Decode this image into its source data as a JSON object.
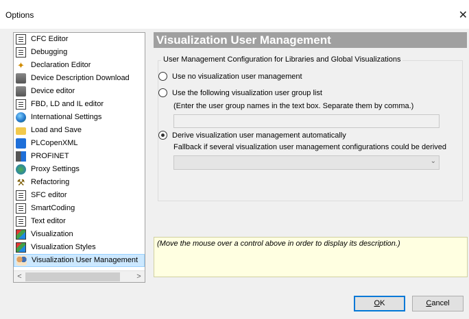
{
  "window": {
    "title": "Options",
    "close_glyph": "✕"
  },
  "tree": {
    "items": [
      {
        "label": "CFC Editor",
        "icon": "doc-icon"
      },
      {
        "label": "Debugging",
        "icon": "debug-icon"
      },
      {
        "label": "Declaration Editor",
        "icon": "declaration-icon"
      },
      {
        "label": "Device Description Download",
        "icon": "device-download-icon"
      },
      {
        "label": "Device editor",
        "icon": "device-icon"
      },
      {
        "label": "FBD, LD and IL editor",
        "icon": "fbd-icon"
      },
      {
        "label": "International Settings",
        "icon": "globe-icon"
      },
      {
        "label": "Load and Save",
        "icon": "folder-icon"
      },
      {
        "label": "PLCopenXML",
        "icon": "plcopen-icon"
      },
      {
        "label": "PROFINET",
        "icon": "profinet-icon"
      },
      {
        "label": "Proxy Settings",
        "icon": "proxy-icon"
      },
      {
        "label": "Refactoring",
        "icon": "refactoring-icon"
      },
      {
        "label": "SFC editor",
        "icon": "sfc-icon"
      },
      {
        "label": "SmartCoding",
        "icon": "smartcoding-icon"
      },
      {
        "label": "Text editor",
        "icon": "text-editor-icon"
      },
      {
        "label": "Visualization",
        "icon": "visualization-icon"
      },
      {
        "label": "Visualization Styles",
        "icon": "visualization-styles-icon"
      },
      {
        "label": "Visualization User Management",
        "icon": "user-management-icon",
        "selected": true
      }
    ],
    "scroll_left": "<",
    "scroll_right": ">"
  },
  "panel": {
    "title": "Visualization User Management",
    "group_label": "User Management Configuration for Libraries and Global Visualizations",
    "options": [
      {
        "label": "Use no visualization user management",
        "checked": false
      },
      {
        "label": "Use the following visualization user group list",
        "checked": false
      },
      {
        "label": "Derive visualization user management automatically",
        "checked": true
      }
    ],
    "group_list_hint": "(Enter the user group names in the text box. Separate them by comma.)",
    "group_list_value": "",
    "fallback_label": "Fallback if several visualization user management configurations could be derived",
    "fallback_value": ""
  },
  "description": "(Move the mouse over a control above in order to display its description.)",
  "buttons": {
    "ok_mnemonic": "O",
    "ok_rest": "K",
    "cancel_mnemonic": "C",
    "cancel_rest": "ancel"
  }
}
